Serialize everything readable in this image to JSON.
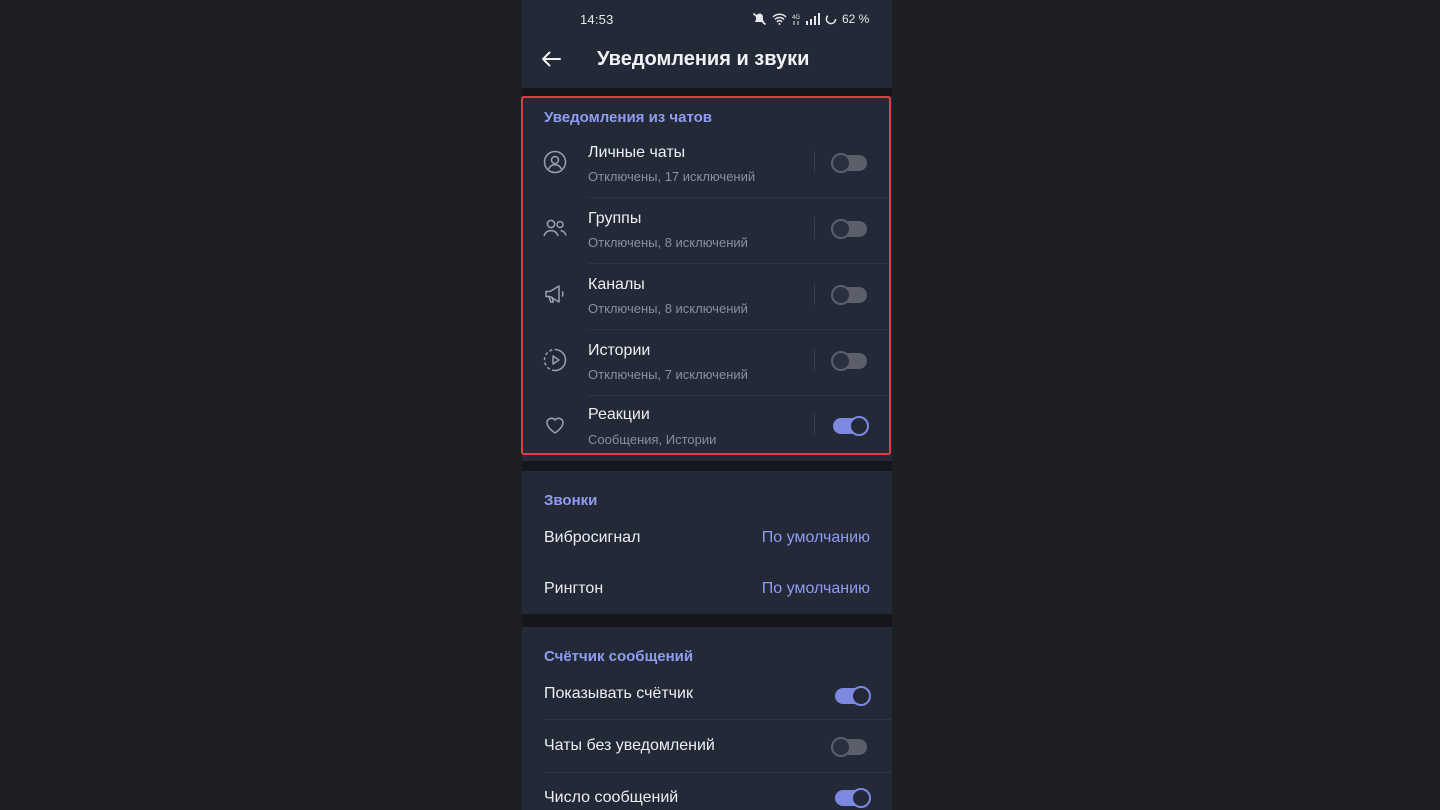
{
  "status_bar": {
    "time": "14:53",
    "battery": "62 %",
    "icons": [
      "mute-icon",
      "wifi-icon",
      "lte-icon",
      "signal-icon",
      "battery-ring-icon"
    ]
  },
  "header": {
    "title": "Уведомления и звуки",
    "back_icon": "arrow-left-icon"
  },
  "chat_notifications": {
    "header": "Уведомления из чатов",
    "items": [
      {
        "icon": "person-icon",
        "title": "Личные чаты",
        "subtitle": "Отключены, 17 исключений",
        "enabled": false
      },
      {
        "icon": "group-icon",
        "title": "Группы",
        "subtitle": "Отключены, 8 исключений",
        "enabled": false
      },
      {
        "icon": "megaphone-icon",
        "title": "Каналы",
        "subtitle": "Отключены, 8 исключений",
        "enabled": false
      },
      {
        "icon": "stories-icon",
        "title": "Истории",
        "subtitle": "Отключены, 7 исключений",
        "enabled": false
      },
      {
        "icon": "heart-icon",
        "title": "Реакции",
        "subtitle": "Сообщения, Истории",
        "enabled": true
      }
    ]
  },
  "calls": {
    "header": "Звонки",
    "items": [
      {
        "title": "Вибросигнал",
        "value": "По умолчанию"
      },
      {
        "title": "Рингтон",
        "value": "По умолчанию"
      }
    ]
  },
  "badge_counter": {
    "header": "Счётчик сообщений",
    "items": [
      {
        "title": "Показывать счётчик",
        "enabled": true
      },
      {
        "title": "Чаты без уведомлений",
        "enabled": false
      },
      {
        "title": "Число сообщений",
        "enabled": true
      }
    ]
  },
  "colors": {
    "accent": "#8f9cf2",
    "toggle_on": "#7d89e0",
    "panel": "#242938",
    "highlight_border": "#e23b43"
  }
}
